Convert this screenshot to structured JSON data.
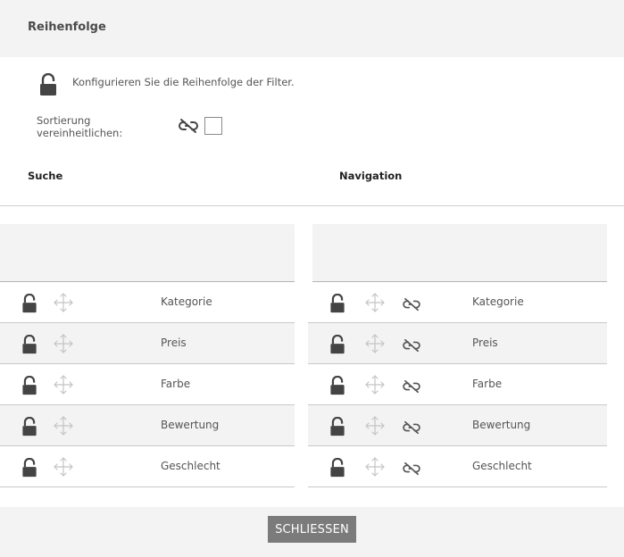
{
  "dialog": {
    "title": "Reihenfolge",
    "info_text": "Konfigurieren Sie die Reihenfolge der Filter.",
    "sort_label": "Sortierung vereinheitlichen:",
    "sort_checked": false,
    "close_label": "SCHLIESSEN"
  },
  "search": {
    "heading": "Suche",
    "rows": [
      {
        "label": "Kategorie",
        "lock_icon": "lock-icon",
        "move_icon": "move-icon"
      },
      {
        "label": "Preis",
        "lock_icon": "lock-icon",
        "move_icon": "move-icon"
      },
      {
        "label": "Farbe",
        "lock_icon": "lock-icon",
        "move_icon": "move-icon"
      },
      {
        "label": "Bewertung",
        "lock_icon": "lock-icon",
        "move_icon": "move-icon"
      },
      {
        "label": "Geschlecht",
        "lock_icon": "lock-icon",
        "move_icon": "move-icon"
      }
    ]
  },
  "navigation": {
    "heading": "Navigation",
    "rows": [
      {
        "label": "Kategorie",
        "lock_icon": "lock-icon",
        "move_icon": "move-icon",
        "unlink_icon": "unlink-icon"
      },
      {
        "label": "Preis",
        "lock_icon": "lock-icon",
        "move_icon": "move-icon",
        "unlink_icon": "unlink-icon"
      },
      {
        "label": "Farbe",
        "lock_icon": "lock-icon",
        "move_icon": "move-icon",
        "unlink_icon": "unlink-icon"
      },
      {
        "label": "Bewertung",
        "lock_icon": "lock-icon",
        "move_icon": "move-icon",
        "unlink_icon": "unlink-icon"
      },
      {
        "label": "Geschlecht",
        "lock_icon": "lock-icon",
        "move_icon": "move-icon",
        "unlink_icon": "unlink-icon"
      }
    ]
  },
  "colors": {
    "header_bg": "#f3f3f3",
    "button_bg": "#7b7b7b",
    "icon_dark": "#444444",
    "icon_light": "#c4c4c4"
  }
}
